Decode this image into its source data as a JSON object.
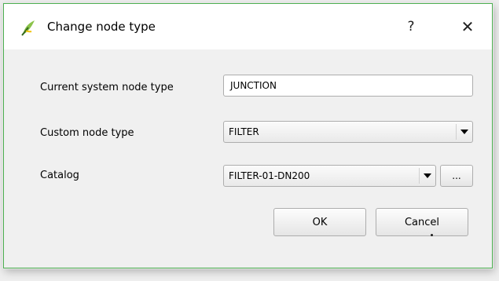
{
  "window": {
    "title": "Change node type",
    "help_label": "?",
    "close_label": "✕",
    "app_icon": "qgis-icon"
  },
  "form": {
    "current_label": "Current system node type",
    "current_value": "JUNCTION",
    "custom_label": "Custom node type",
    "custom_value": "FILTER",
    "catalog_label": "Catalog",
    "catalog_value": "FILTER-01-DN200",
    "browse_label": "..."
  },
  "buttons": {
    "ok_label": "OK",
    "cancel_label": "Cancel"
  },
  "colors": {
    "border_accent": "#4caf50",
    "window_bg": "#f0f0f0"
  }
}
